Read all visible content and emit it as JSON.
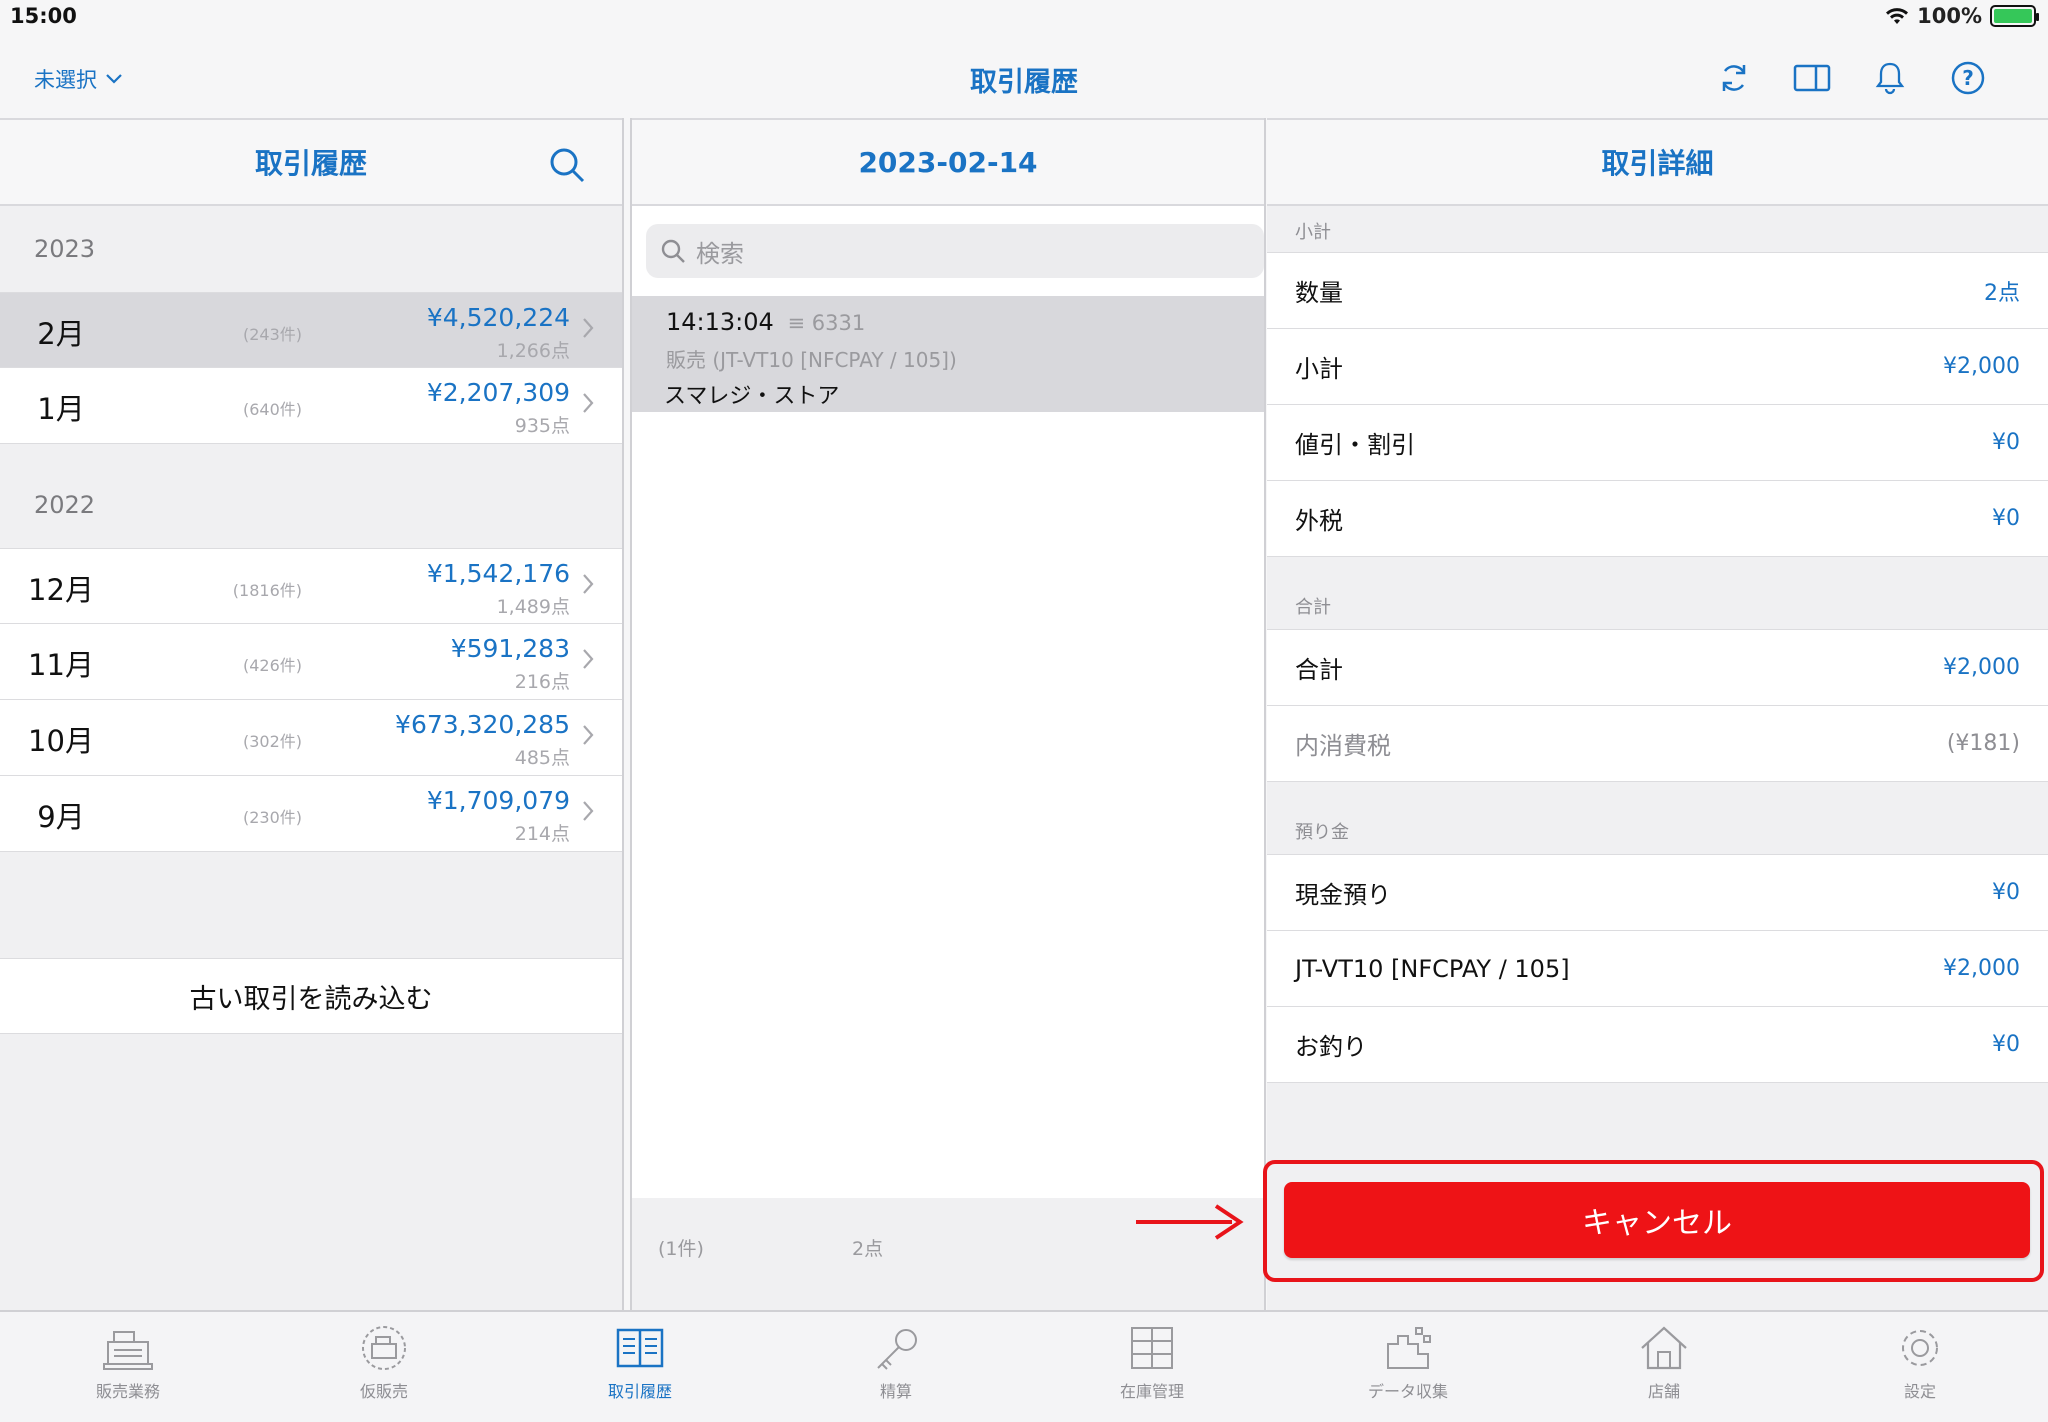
{
  "status_bar": {
    "time": "15:00",
    "battery": "100%"
  },
  "navbar": {
    "store_select": "未選択",
    "title": "取引履歴"
  },
  "history_panel": {
    "title": "取引履歴",
    "groups": [
      {
        "year": "2023",
        "months": [
          {
            "month": "2月",
            "count": "(243件)",
            "amount": "¥4,520,224",
            "points": "1,266点"
          },
          {
            "month": "1月",
            "count": "(640件)",
            "amount": "¥2,207,309",
            "points": "935点"
          }
        ]
      },
      {
        "year": "2022",
        "months": [
          {
            "month": "12月",
            "count": "(1816件)",
            "amount": "¥1,542,176",
            "points": "1,489点"
          },
          {
            "month": "11月",
            "count": "(426件)",
            "amount": "¥591,283",
            "points": "216点"
          },
          {
            "month": "10月",
            "count": "(302件)",
            "amount": "¥673,320,285",
            "points": "485点"
          },
          {
            "month": "9月",
            "count": "(230件)",
            "amount": "¥1,709,079",
            "points": "214点"
          }
        ]
      }
    ],
    "load_older": "古い取引を読み込む"
  },
  "day_panel": {
    "date": "2023-02-14",
    "search_placeholder": "検索",
    "transaction": {
      "time": "14:13:04",
      "number": "6331",
      "type": "販売 (JT-VT10 [NFCPAY / 105])",
      "store": "スマレジ・ストア"
    },
    "footer_count": "(1件)",
    "footer_points": "2点"
  },
  "detail_panel": {
    "title": "取引詳細",
    "subtotal_header": "小計",
    "qty_label": "数量",
    "qty_value": "2点",
    "subtotal_label": "小計",
    "subtotal_value": "¥2,000",
    "discount_label": "値引・割引",
    "discount_value": "¥0",
    "ext_tax_label": "外税",
    "ext_tax_value": "¥0",
    "total_header": "合計",
    "total_label": "合計",
    "total_value": "¥2,000",
    "inner_tax_label": "内消費税",
    "inner_tax_value": "(¥181)",
    "deposit_header": "預り金",
    "cash_label": "現金預り",
    "cash_value": "¥0",
    "card_label": "JT-VT10 [NFCPAY / 105]",
    "card_value": "¥2,000",
    "change_label": "お釣り",
    "change_value": "¥0",
    "cancel_button": "キャンセル"
  },
  "tabbar": {
    "tabs": [
      {
        "label": "販売業務",
        "icon": "register-icon"
      },
      {
        "label": "仮販売",
        "icon": "temp-register-icon"
      },
      {
        "label": "取引履歴",
        "icon": "history-book-icon",
        "active": true
      },
      {
        "label": "精算",
        "icon": "key-icon"
      },
      {
        "label": "在庫管理",
        "icon": "inventory-icon"
      },
      {
        "label": "データ収集",
        "icon": "data-collect-icon"
      },
      {
        "label": "店舗",
        "icon": "store-home-icon"
      },
      {
        "label": "設定",
        "icon": "gear-icon"
      }
    ]
  },
  "colors": {
    "accent": "#1a73c4",
    "cancel": "#ee1316",
    "highlight": "#e8141a"
  }
}
